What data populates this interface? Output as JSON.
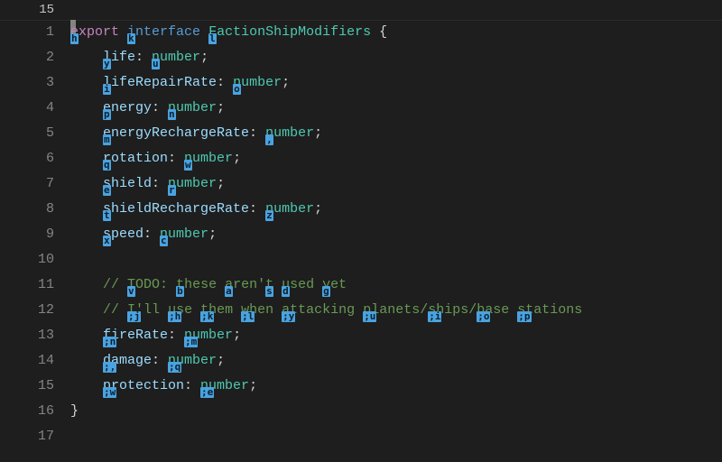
{
  "breadcrumb_line": "15",
  "lines": [
    {
      "num": "1",
      "indent": 0,
      "tokens": [
        {
          "cls": "tok-keyword",
          "hint": "h",
          "text": "export"
        },
        {
          "cls": "",
          "text": " "
        },
        {
          "cls": "tok-storage",
          "hint": "k",
          "text": "interface"
        },
        {
          "cls": "",
          "text": " "
        },
        {
          "cls": "tok-type",
          "hint": "l",
          "text": "FactionShipModifiers"
        },
        {
          "cls": "",
          "text": " "
        },
        {
          "cls": "tok-punct",
          "text": "{"
        }
      ]
    },
    {
      "num": "2",
      "indent": 1,
      "tokens": [
        {
          "cls": "tok-ident",
          "hint": "y",
          "text": "life"
        },
        {
          "cls": "tok-punct",
          "text": ": "
        },
        {
          "cls": "tok-type",
          "hint": "u",
          "text": "number"
        },
        {
          "cls": "tok-punct",
          "text": ";"
        }
      ]
    },
    {
      "num": "3",
      "indent": 1,
      "tokens": [
        {
          "cls": "tok-ident",
          "hint": "i",
          "text": "lifeRepairRate"
        },
        {
          "cls": "tok-punct",
          "text": ": "
        },
        {
          "cls": "tok-type",
          "hint": "o",
          "text": "number"
        },
        {
          "cls": "tok-punct",
          "text": ";"
        }
      ]
    },
    {
      "num": "4",
      "indent": 1,
      "tokens": [
        {
          "cls": "tok-ident",
          "hint": "p",
          "text": "energy"
        },
        {
          "cls": "tok-punct",
          "text": ": "
        },
        {
          "cls": "tok-type",
          "hint": "n",
          "text": "number"
        },
        {
          "cls": "tok-punct",
          "text": ";"
        }
      ]
    },
    {
      "num": "5",
      "indent": 1,
      "tokens": [
        {
          "cls": "tok-ident",
          "hint": "m",
          "text": "energyRechargeRate"
        },
        {
          "cls": "tok-punct",
          "text": ": "
        },
        {
          "cls": "tok-type",
          "hint": ",",
          "text": "number"
        },
        {
          "cls": "tok-punct",
          "text": ";"
        }
      ]
    },
    {
      "num": "6",
      "indent": 1,
      "tokens": [
        {
          "cls": "tok-ident",
          "hint": "q",
          "text": "rotation"
        },
        {
          "cls": "tok-punct",
          "text": ": "
        },
        {
          "cls": "tok-type",
          "hint": "w",
          "text": "number"
        },
        {
          "cls": "tok-punct",
          "text": ";"
        }
      ]
    },
    {
      "num": "7",
      "indent": 1,
      "tokens": [
        {
          "cls": "tok-ident",
          "hint": "e",
          "text": "shield"
        },
        {
          "cls": "tok-punct",
          "text": ": "
        },
        {
          "cls": "tok-type",
          "hint": "r",
          "text": "number"
        },
        {
          "cls": "tok-punct",
          "text": ";"
        }
      ]
    },
    {
      "num": "8",
      "indent": 1,
      "tokens": [
        {
          "cls": "tok-ident",
          "hint": "t",
          "text": "shieldRechargeRate"
        },
        {
          "cls": "tok-punct",
          "text": ": "
        },
        {
          "cls": "tok-type",
          "hint": "z",
          "text": "number"
        },
        {
          "cls": "tok-punct",
          "text": ";"
        }
      ]
    },
    {
      "num": "9",
      "indent": 1,
      "tokens": [
        {
          "cls": "tok-ident",
          "hint": "x",
          "text": "speed"
        },
        {
          "cls": "tok-punct",
          "text": ": "
        },
        {
          "cls": "tok-type",
          "hint": "c",
          "text": "number"
        },
        {
          "cls": "tok-punct",
          "text": ";"
        }
      ]
    },
    {
      "num": "10",
      "indent": 0,
      "tokens": []
    },
    {
      "num": "11",
      "indent": 1,
      "tokens": [
        {
          "cls": "tok-comment",
          "text": "// "
        },
        {
          "cls": "tok-comment",
          "hint": "v",
          "text": "TODO:"
        },
        {
          "cls": "tok-comment",
          "text": " "
        },
        {
          "cls": "tok-comment",
          "hint": "b",
          "text": "these"
        },
        {
          "cls": "tok-comment",
          "text": " "
        },
        {
          "cls": "tok-comment",
          "hint": "a",
          "text": "aren'"
        },
        {
          "cls": "tok-comment",
          "hint": "s",
          "text": "t"
        },
        {
          "cls": "tok-comment",
          "text": " "
        },
        {
          "cls": "tok-comment",
          "hint": "d",
          "text": "used"
        },
        {
          "cls": "tok-comment",
          "text": " "
        },
        {
          "cls": "tok-comment",
          "hint": "g",
          "text": "yet"
        }
      ]
    },
    {
      "num": "12",
      "indent": 1,
      "tokens": [
        {
          "cls": "tok-comment",
          "text": "// "
        },
        {
          "cls": "tok-comment",
          "hint": ";j",
          "text": "I'll"
        },
        {
          "cls": "tok-comment",
          "text": " "
        },
        {
          "cls": "tok-comment",
          "hint": ";h",
          "text": "use"
        },
        {
          "cls": "tok-comment",
          "text": " "
        },
        {
          "cls": "tok-comment",
          "hint": ";k",
          "text": "them"
        },
        {
          "cls": "tok-comment",
          "text": " "
        },
        {
          "cls": "tok-comment",
          "hint": ";l",
          "text": "when"
        },
        {
          "cls": "tok-comment",
          "text": " "
        },
        {
          "cls": "tok-comment",
          "hint": ";y",
          "text": "attacking"
        },
        {
          "cls": "tok-comment",
          "text": " "
        },
        {
          "cls": "tok-comment",
          "hint": ";u",
          "text": "planets/"
        },
        {
          "cls": "tok-comment",
          "hint": ";i",
          "text": "ships/"
        },
        {
          "cls": "tok-comment",
          "hint": ";o",
          "text": "base"
        },
        {
          "cls": "tok-comment",
          "text": " "
        },
        {
          "cls": "tok-comment",
          "hint": ";p",
          "text": "stations"
        }
      ]
    },
    {
      "num": "13",
      "indent": 1,
      "tokens": [
        {
          "cls": "tok-ident",
          "hint": ";n",
          "text": "fireRate"
        },
        {
          "cls": "tok-punct",
          "text": ": "
        },
        {
          "cls": "tok-type",
          "hint": ";m",
          "text": "number"
        },
        {
          "cls": "tok-punct",
          "text": ";"
        }
      ]
    },
    {
      "num": "14",
      "indent": 1,
      "tokens": [
        {
          "cls": "tok-ident",
          "hint": ";,",
          "text": "damage"
        },
        {
          "cls": "tok-punct",
          "text": ": "
        },
        {
          "cls": "tok-type",
          "hint": ";q",
          "text": "number"
        },
        {
          "cls": "tok-punct",
          "text": ";"
        }
      ]
    },
    {
      "num": "15",
      "indent": 1,
      "tokens": [
        {
          "cls": "tok-ident",
          "hint": ";w",
          "text": "protection"
        },
        {
          "cls": "tok-punct",
          "text": ": "
        },
        {
          "cls": "tok-type",
          "hint": ";e",
          "text": "number"
        },
        {
          "cls": "tok-punct",
          "text": ";"
        }
      ]
    },
    {
      "num": "16",
      "indent": 0,
      "tokens": [
        {
          "cls": "tok-punct",
          "text": "}"
        }
      ]
    },
    {
      "num": "17",
      "indent": 0,
      "tokens": []
    }
  ]
}
